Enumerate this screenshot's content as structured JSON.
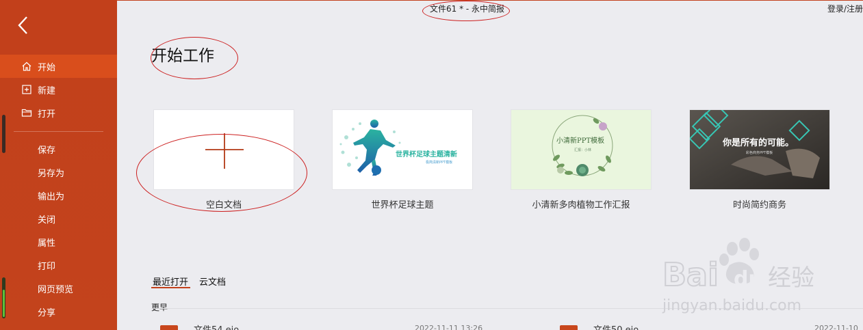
{
  "window": {
    "title": "文件61 * - 永中简报",
    "login_label": "登录/注册"
  },
  "sidebar": {
    "back_icon": "chevron-left-icon",
    "primary_items": [
      {
        "label": "开始",
        "icon": "home-icon",
        "active": true
      },
      {
        "label": "新建",
        "icon": "plus-square-icon",
        "active": false
      },
      {
        "label": "打开",
        "icon": "folder-icon",
        "active": false
      }
    ],
    "secondary_items": [
      {
        "label": "保存"
      },
      {
        "label": "另存为"
      },
      {
        "label": "输出为"
      },
      {
        "label": "关闭"
      },
      {
        "label": "属性"
      },
      {
        "label": "打印"
      },
      {
        "label": "网页预览"
      },
      {
        "label": "分享"
      }
    ]
  },
  "main": {
    "title": "开始工作",
    "templates": [
      {
        "caption": "空白文档",
        "thumb_plus": "+"
      },
      {
        "caption": "世界杯足球主题",
        "thumb_title": "世界杯足球主题清新",
        "thumb_sub": "极简清新PPT模板"
      },
      {
        "caption": "小清新多肉植物工作汇报",
        "thumb_title": "小清新PPT模板",
        "thumb_sub": "汇报：小林"
      },
      {
        "caption": "时尚简约商务",
        "thumb_title": "你是所有的可能。",
        "thumb_sub": "彩色商务PPT模板"
      }
    ],
    "tabs": [
      {
        "label": "最近打开",
        "active": true
      },
      {
        "label": "云文档",
        "active": false
      }
    ],
    "section_label": "更早",
    "recent": [
      {
        "name": "文件54.eio",
        "date": "2022-11-11 13:26"
      },
      {
        "name": "文件50.eio",
        "date": "2022-11-10"
      }
    ]
  },
  "watermark": {
    "brand_left": "Bai",
    "brand_right": "经验",
    "url": "jingyan.baidu.com"
  },
  "colors": {
    "accent": "#c2401b",
    "active_item": "#d94e1c",
    "annotation": "#cc1f1f",
    "background": "#ececf0"
  }
}
